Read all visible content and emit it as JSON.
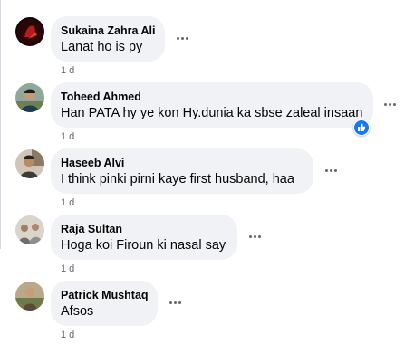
{
  "comments": [
    {
      "author": "Sukaina Zahra Ali",
      "text": "Lanat ho is py",
      "time": "1 d",
      "avatar_icon": "dark-red-profile-avatar"
    },
    {
      "author": "Toheed Ahmed",
      "text": "Han PATA hy ye kon Hy.dunia ka sbse zaleal insaan",
      "time": "1 d",
      "avatar_icon": "person-outdoor-avatar",
      "reaction_icon": "like-icon"
    },
    {
      "author": "Haseeb Alvi",
      "text": "I think pinki pirni kaye first husband, haa",
      "time": "1 d",
      "avatar_icon": "person-indoor-avatar"
    },
    {
      "author": "Raja Sultan",
      "text": "Hoga koi Firoun ki nasal say",
      "time": "1 d",
      "avatar_icon": "group-photo-avatar"
    },
    {
      "author": "Patrick Mushtaq",
      "text": "Afsos",
      "time": "1 d",
      "avatar_icon": "landscape-avatar"
    }
  ],
  "colors": {
    "bubble": "#f0f2f5",
    "muted_text": "#65676b",
    "like_blue": "#1877f2"
  }
}
